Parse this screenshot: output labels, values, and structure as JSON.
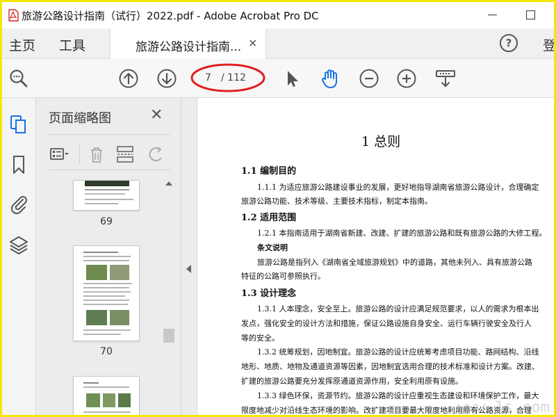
{
  "window": {
    "title": "旅游公路设计指南（试行）2022.pdf - Adobe Acrobat Pro DC"
  },
  "tabs": {
    "home": "主页",
    "tools": "工具",
    "document": "旅游公路设计指南...",
    "close_symbol": "×",
    "help_symbol": "?",
    "signin": "登"
  },
  "toolbar": {
    "page_current": "7",
    "page_total": "/ 112",
    "icons": [
      "zoom-search-icon",
      "page-up-icon",
      "page-down-icon",
      "select-cursor-icon",
      "hand-tool-icon",
      "zoom-out-icon",
      "zoom-in-icon",
      "scroll-mode-icon"
    ],
    "highlight_color": "#e02020"
  },
  "sidebar_rail": {
    "icons": [
      "page-thumbnails-icon",
      "bookmarks-icon",
      "attachments-icon",
      "layers-icon"
    ],
    "active_color": "#1473e6"
  },
  "thumbnails_panel": {
    "title": "页面缩略图",
    "close_symbol": "✕",
    "pages": [
      "69",
      "70"
    ]
  },
  "document": {
    "lines": [
      {
        "text": "1  总则",
        "style": "h1"
      },
      {
        "text": "1.1  编制目的",
        "style": "h2"
      },
      {
        "text": "1.1.1  为适应旅游公路建设事业的发展，更好地指导湖南省旅游公路设计，合理确定",
        "style": "p"
      },
      {
        "text": "旅游公路功能、技术等级、主要技术指标，制定本指南。",
        "style": "p"
      },
      {
        "text": "1.2  适用范围",
        "style": "h2"
      },
      {
        "text": "1.2.1  本指南适用于湖南省新建、改建、扩建的旅游公路和既有旅游公路的大修工程。",
        "style": "p"
      },
      {
        "text": "条文说明",
        "style": "pb"
      },
      {
        "text": "旅游公路是指列入《湖南省全域旅游规划》中的道路，其他未列入、具有旅游公路",
        "style": "p"
      },
      {
        "text": "特征的公路可参照执行。",
        "style": "p"
      },
      {
        "text": "1.3  设计理念",
        "style": "h2"
      },
      {
        "text": "1.3.1  人本理念，安全至上。旅游公路的设计应满足规范要求，以人的需求为根本出",
        "style": "p"
      },
      {
        "text": "发点，强化安全的设计方法和措施，保证公路设施自身安全、运行车辆行驶安全及行人",
        "style": "p"
      },
      {
        "text": "等的安全。",
        "style": "p"
      },
      {
        "text": "1.3.2  统筹规划，因地制宜。旅游公路的设计应统筹考虑项目功能、路网结构、沿线",
        "style": "p"
      },
      {
        "text": "地形、地质、地物及通道资源等因素，因地制宜选用合理的技术标准和设计方案。改建、",
        "style": "p"
      },
      {
        "text": "扩建的旅游公路要充分发挥原通道资源作用，安全利用原有设施。",
        "style": "p"
      },
      {
        "text": "1.3.3  绿色环保，资源节约。旅游公路的设计应重视生态建设和环境保护工作，最大",
        "style": "p"
      },
      {
        "text": "限度地减少对沿线生态环境的影响。改扩建项目要最大限度地利用原有公路资源，合理",
        "style": "p"
      }
    ],
    "watermark": "www.1s.com"
  }
}
